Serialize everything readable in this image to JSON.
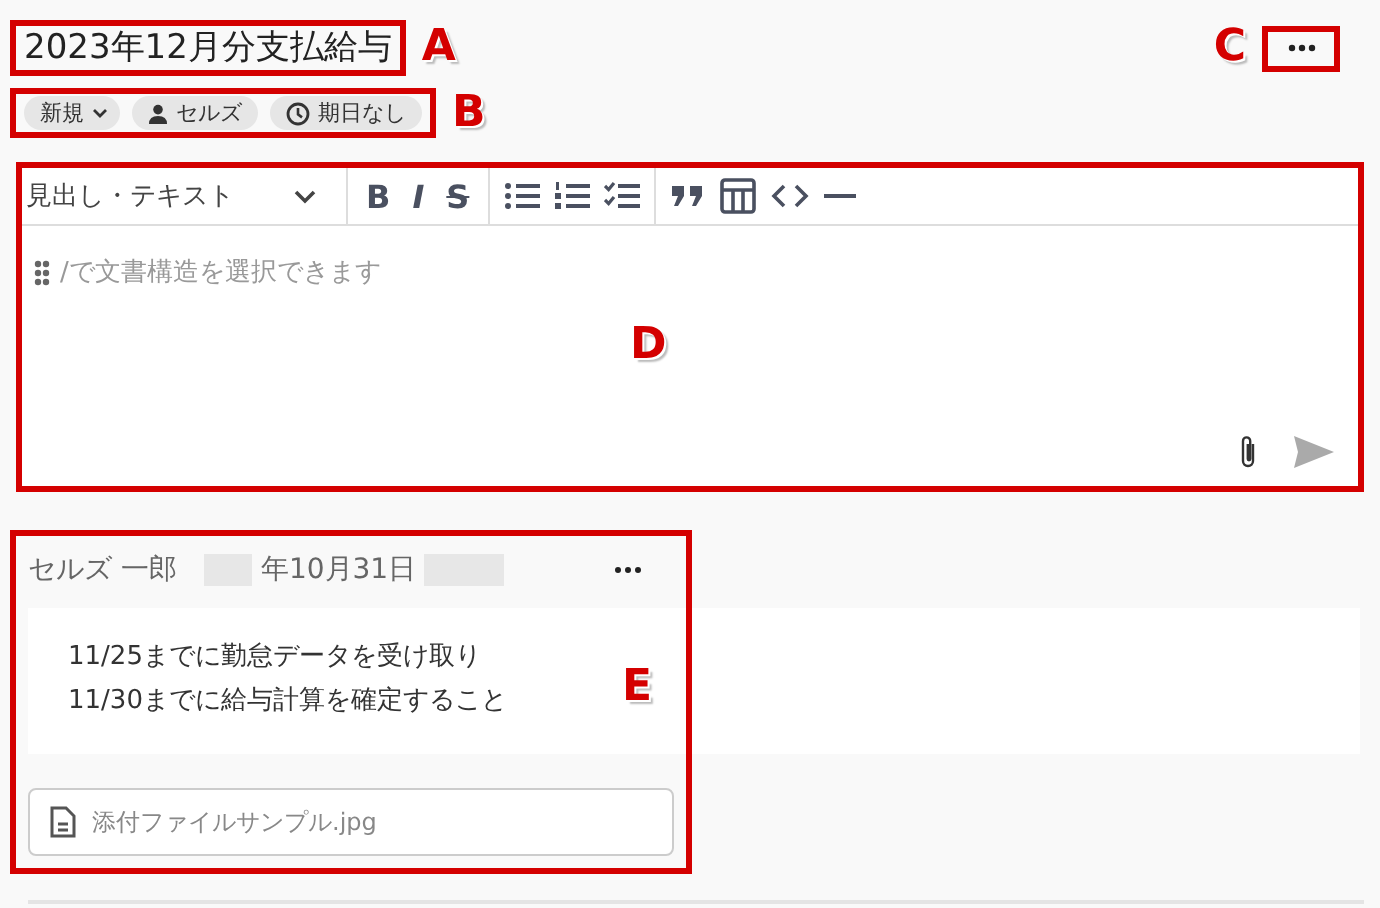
{
  "title": {
    "text": "2023年12月分支払給与",
    "callout": "A"
  },
  "more_button": {
    "callout": "C"
  },
  "chips": {
    "callout": "B",
    "items": [
      {
        "kind": "status",
        "label": "新規"
      },
      {
        "kind": "assignee",
        "label": "セルズ"
      },
      {
        "kind": "due",
        "label": "期日なし"
      }
    ]
  },
  "editor": {
    "callout": "D",
    "format_select": "見出し・テキスト",
    "format_buttons": [
      {
        "kind": "bold",
        "label": "B"
      },
      {
        "kind": "italic",
        "label": "I"
      },
      {
        "kind": "strike",
        "label": "S"
      }
    ],
    "placeholder": "/で文書構造を選択できます"
  },
  "comment": {
    "callout": "E",
    "author": "セルズ 一郎",
    "date": "年10月31日",
    "lines": [
      "11/25までに勤怠データを受け取り",
      "11/30までに給与計算を確定すること"
    ],
    "attachment": "添付ファイルサンプル.jpg"
  }
}
